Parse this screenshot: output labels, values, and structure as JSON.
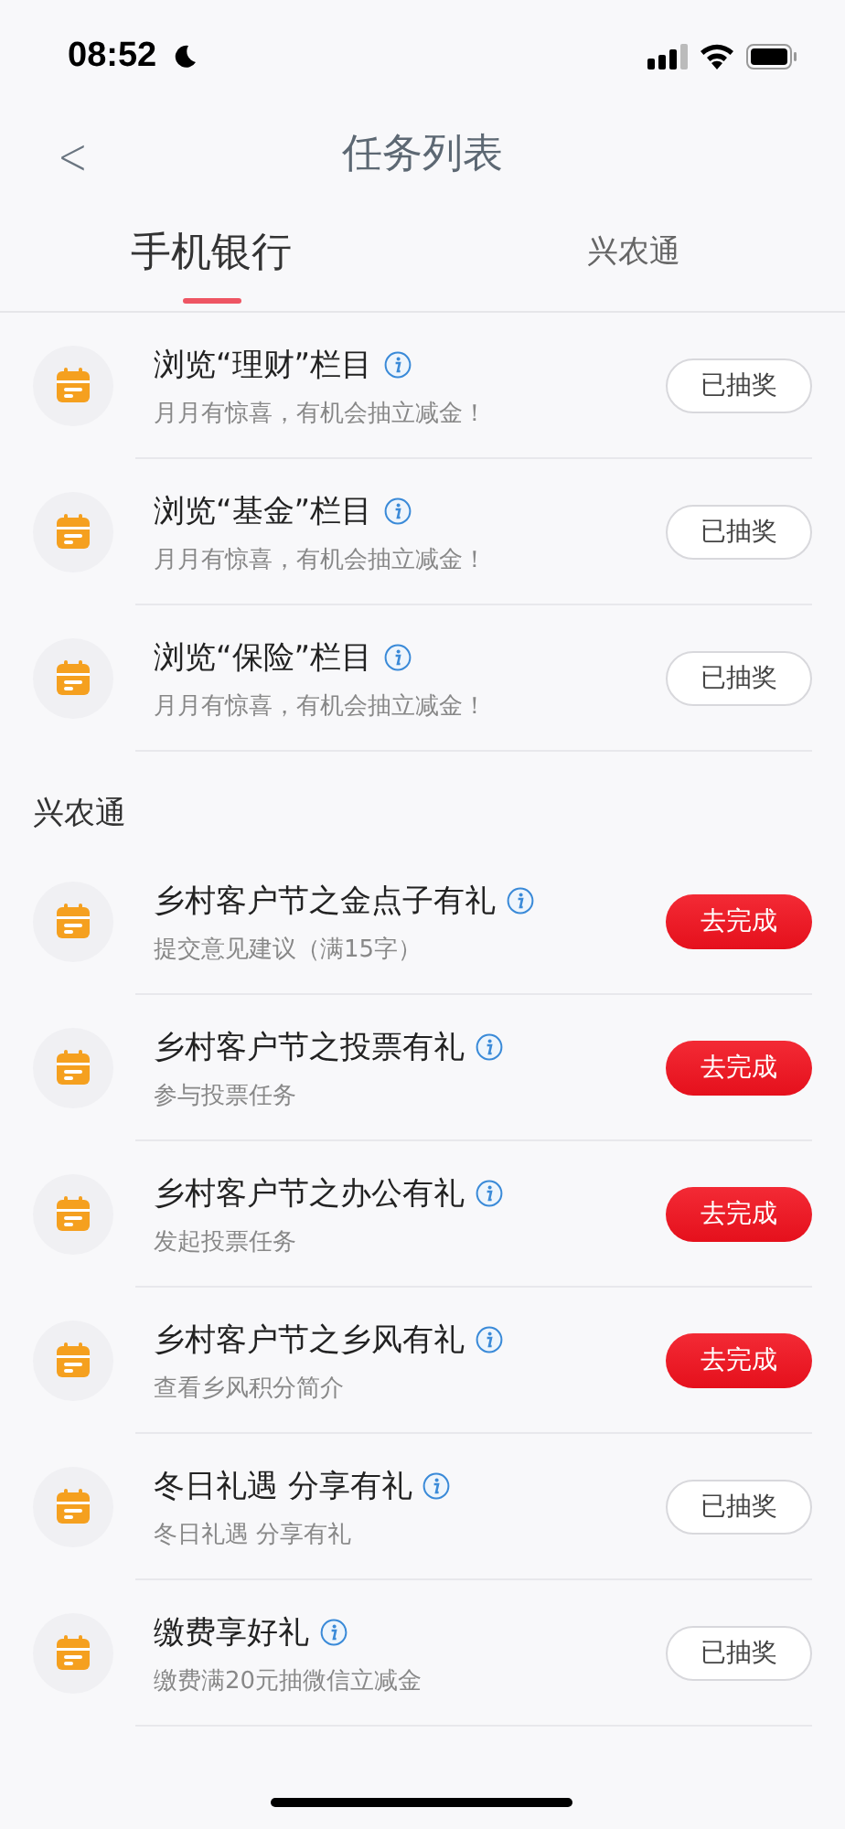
{
  "status_bar": {
    "time": "08:52"
  },
  "nav": {
    "back": "<",
    "title": "任务列表"
  },
  "tabs": [
    {
      "label": "手机银行",
      "selected": true
    },
    {
      "label": "兴农通",
      "selected": false
    }
  ],
  "sections": [
    {
      "tasks": [
        {
          "title": "浏览“理财”栏目",
          "subtitle": "月月有惊喜，有机会抽立减金！",
          "kind": "claimed",
          "action": "已抽奖"
        },
        {
          "title": "浏览“基金”栏目",
          "subtitle": "月月有惊喜，有机会抽立减金！",
          "kind": "claimed",
          "action": "已抽奖"
        },
        {
          "title": "浏览“保险”栏目",
          "subtitle": "月月有惊喜，有机会抽立减金！",
          "kind": "claimed",
          "action": "已抽奖"
        }
      ]
    },
    {
      "heading": "兴农通",
      "tasks": [
        {
          "title": "乡村客户节之金点子有礼",
          "subtitle": "提交意见建议（满15字）",
          "kind": "pending",
          "action": "去完成"
        },
        {
          "title": "乡村客户节之投票有礼",
          "subtitle": "参与投票任务",
          "kind": "pending",
          "action": "去完成"
        },
        {
          "title": "乡村客户节之办公有礼",
          "subtitle": "发起投票任务",
          "kind": "pending",
          "action": "去完成"
        },
        {
          "title": "乡村客户节之乡风有礼",
          "subtitle": "查看乡风积分简介",
          "kind": "pending",
          "action": "去完成"
        },
        {
          "title": "冬日礼遇 分享有礼",
          "subtitle": "冬日礼遇 分享有礼",
          "kind": "claimed",
          "action": "已抽奖"
        },
        {
          "title": "缴费享好礼",
          "subtitle": "缴费满20元抽微信立减金",
          "kind": "claimed",
          "action": "已抽奖"
        }
      ]
    }
  ]
}
